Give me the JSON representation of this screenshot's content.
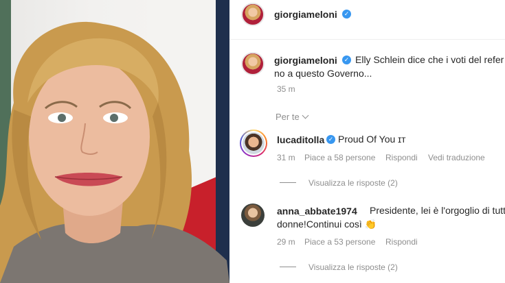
{
  "post": {
    "author": "giorgiameloni",
    "caption_line1": "Elly Schlein dice che i voti del refer",
    "caption_line2": "no a questo Governo...",
    "time": "35 m",
    "filter_label": "Per te"
  },
  "comments": [
    {
      "user": "lucaditolla",
      "verified": true,
      "text": "Proud Of You ɪт",
      "time": "31 m",
      "likes": "Piace a 58 persone",
      "reply": "Rispondi",
      "translate": "Vedi traduzione",
      "view_replies": "Visualizza le risposte (2)"
    },
    {
      "user": "anna_abbate1974",
      "verified": false,
      "text_line1": "Presidente, lei è l'orgoglio di tutte",
      "text_line2": "donne!Continui così",
      "emoji": "👏",
      "time": "29 m",
      "likes": "Piace a 53 persone",
      "reply": "Rispondi",
      "view_replies": "Visualizza le risposte (2)"
    }
  ],
  "colors": {
    "verified": "#3897f0",
    "muted": "#8e8e8e",
    "text": "#262626"
  }
}
